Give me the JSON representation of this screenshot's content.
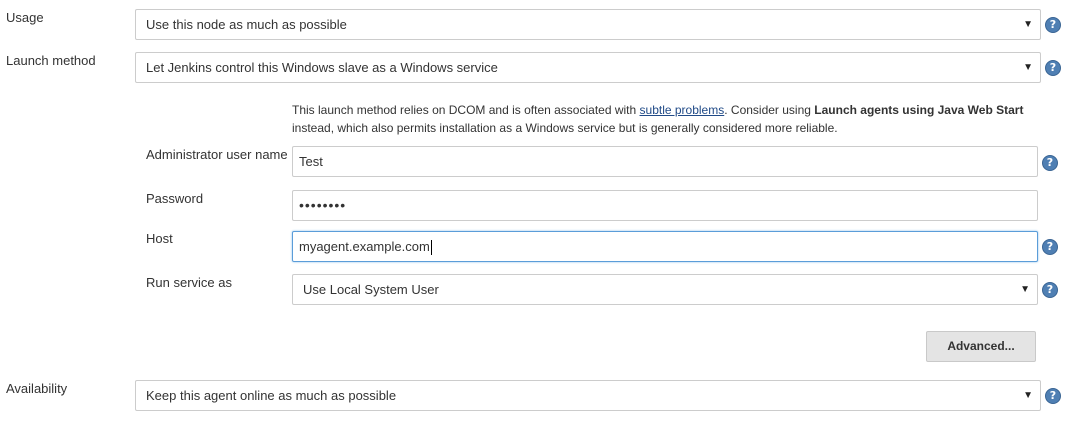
{
  "usage": {
    "label": "Usage",
    "value": "Use this node as much as possible"
  },
  "launch_method": {
    "label": "Launch method",
    "value": "Let Jenkins control this Windows slave as a Windows service",
    "description_prefix": "This launch method relies on DCOM and is often associated with ",
    "description_link": "subtle problems",
    "description_mid": ". Consider using ",
    "description_bold": "Launch agents using Java Web Start",
    "description_suffix": " instead, which also permits installation as a Windows service but is generally considered more reliable."
  },
  "admin_user": {
    "label": "Administrator user name",
    "value": "Test"
  },
  "password": {
    "label": "Password",
    "value": "••••••••"
  },
  "host": {
    "label": "Host",
    "value": "myagent.example.com"
  },
  "run_service_as": {
    "label": "Run service as",
    "value": "Use Local System User"
  },
  "advanced_button": "Advanced...",
  "availability": {
    "label": "Availability",
    "value": "Keep this agent online as much as possible"
  },
  "help_glyph": "?",
  "caret_glyph": "▼",
  "icons": {
    "help": "help-icon",
    "caret": "chevron-down-icon"
  }
}
